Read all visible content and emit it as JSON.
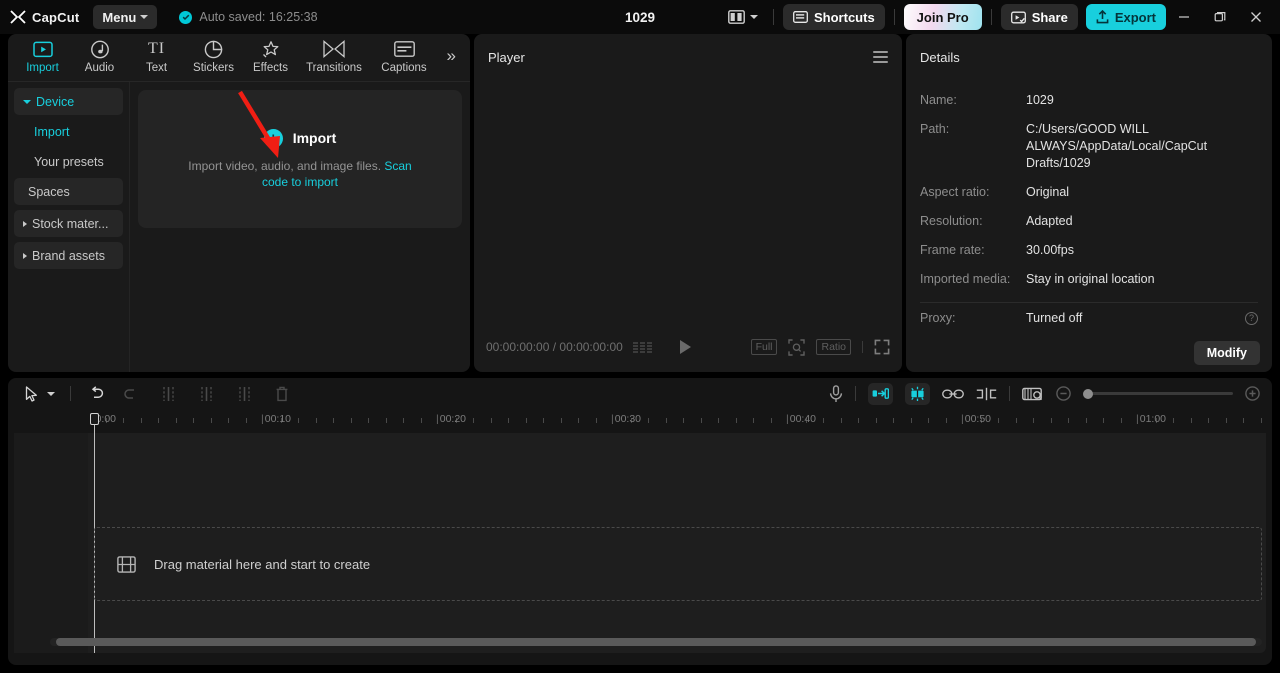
{
  "app": {
    "name": "CapCut",
    "menu_label": "Menu",
    "autosave_text": "Auto saved: 16:25:38",
    "project_title": "1029"
  },
  "titlebar": {
    "layout_icon": "panel-layout-icon",
    "shortcuts_label": "Shortcuts",
    "join_pro_label": "Join Pro",
    "share_label": "Share",
    "export_label": "Export",
    "minimize": "—",
    "maximize": "❐",
    "close": "✕"
  },
  "tabs": [
    {
      "label": "Import",
      "icon": "import-icon",
      "active": true
    },
    {
      "label": "Audio",
      "icon": "audio-icon",
      "active": false
    },
    {
      "label": "Text",
      "icon": "text-icon",
      "active": false
    },
    {
      "label": "Stickers",
      "icon": "stickers-icon",
      "active": false
    },
    {
      "label": "Effects",
      "icon": "effects-icon",
      "active": false
    },
    {
      "label": "Transitions",
      "icon": "transitions-icon",
      "active": false
    },
    {
      "label": "Captions",
      "icon": "captions-icon",
      "active": false
    }
  ],
  "tabs_more_label": "»",
  "sidebar": {
    "items": [
      {
        "label": "Device",
        "state": "expanded-accent"
      },
      {
        "label": "Import",
        "state": "sub-active"
      },
      {
        "label": "Your presets",
        "state": "sub"
      },
      {
        "label": "Spaces",
        "state": "box"
      },
      {
        "label": "Stock mater...",
        "state": "box-collapsed"
      },
      {
        "label": "Brand assets",
        "state": "box-collapsed"
      }
    ]
  },
  "import_card": {
    "button_label": "Import",
    "hint_prefix": "Import video, audio, and image files. ",
    "hint_link": "Scan code to import",
    "annotation": "red-arrow"
  },
  "player": {
    "title": "Player",
    "menu_icon": "hamburger-icon",
    "current_time": "00:00:00:00",
    "total_time": "00:00:00:00",
    "timecode": "00:00:00:00 / 00:00:00:00",
    "full_label": "Full",
    "ratio_label": "Ratio"
  },
  "details": {
    "title": "Details",
    "rows": [
      {
        "label": "Name:",
        "value": "1029"
      },
      {
        "label": "Path:",
        "value": "C:/Users/GOOD WILL ALWAYS/AppData/Local/CapCut Drafts/1029"
      },
      {
        "label": "Aspect ratio:",
        "value": "Original"
      },
      {
        "label": "Resolution:",
        "value": "Adapted"
      },
      {
        "label": "Frame rate:",
        "value": "30.00fps"
      },
      {
        "label": "Imported media:",
        "value": "Stay in original location"
      }
    ],
    "proxy": {
      "label": "Proxy:",
      "value": "Turned off",
      "help_icon": "question-mark-icon"
    },
    "modify_label": "Modify"
  },
  "timeline": {
    "ruler_labels": [
      "00:00",
      "00:10",
      "00:20",
      "00:30",
      "00:40",
      "00:50",
      "01:00"
    ],
    "playhead_time": "00:00",
    "dropzone_text": "Drag material here and start to create",
    "dropzone_icon": "media-film-icon",
    "tools_left": [
      {
        "name": "select-cursor-tool",
        "state": "bright"
      },
      {
        "name": "tool-dropdown-chevron",
        "state": "bright"
      },
      {
        "name": "undo-tool",
        "state": "bright"
      },
      {
        "name": "redo-tool",
        "state": "dim"
      },
      {
        "name": "split-tool",
        "state": "dim"
      },
      {
        "name": "trim-left-tool",
        "state": "dim"
      },
      {
        "name": "trim-right-tool",
        "state": "dim"
      },
      {
        "name": "delete-tool",
        "state": "dim"
      }
    ],
    "tools_right": [
      {
        "name": "record-voiceover-tool",
        "state": "normal"
      },
      {
        "name": "snap-to-start-toggle",
        "state": "active"
      },
      {
        "name": "auto-snap-toggle",
        "state": "active"
      },
      {
        "name": "link-clips-tool",
        "state": "normal"
      },
      {
        "name": "split-adjacent-tool",
        "state": "normal"
      },
      {
        "name": "thumbnail-preview-tool",
        "state": "normal"
      },
      {
        "name": "zoom-out-tool",
        "state": "dim"
      },
      {
        "name": "zoom-slider",
        "state": "normal"
      },
      {
        "name": "zoom-in-tool",
        "state": "dim"
      }
    ]
  },
  "colors": {
    "accent": "#18cfdd",
    "panel_bg": "#1a1a1a",
    "window_bg": "#0b0b0b",
    "timeline_bg": "#1e1e1e",
    "annotation_red": "#f01e14"
  }
}
